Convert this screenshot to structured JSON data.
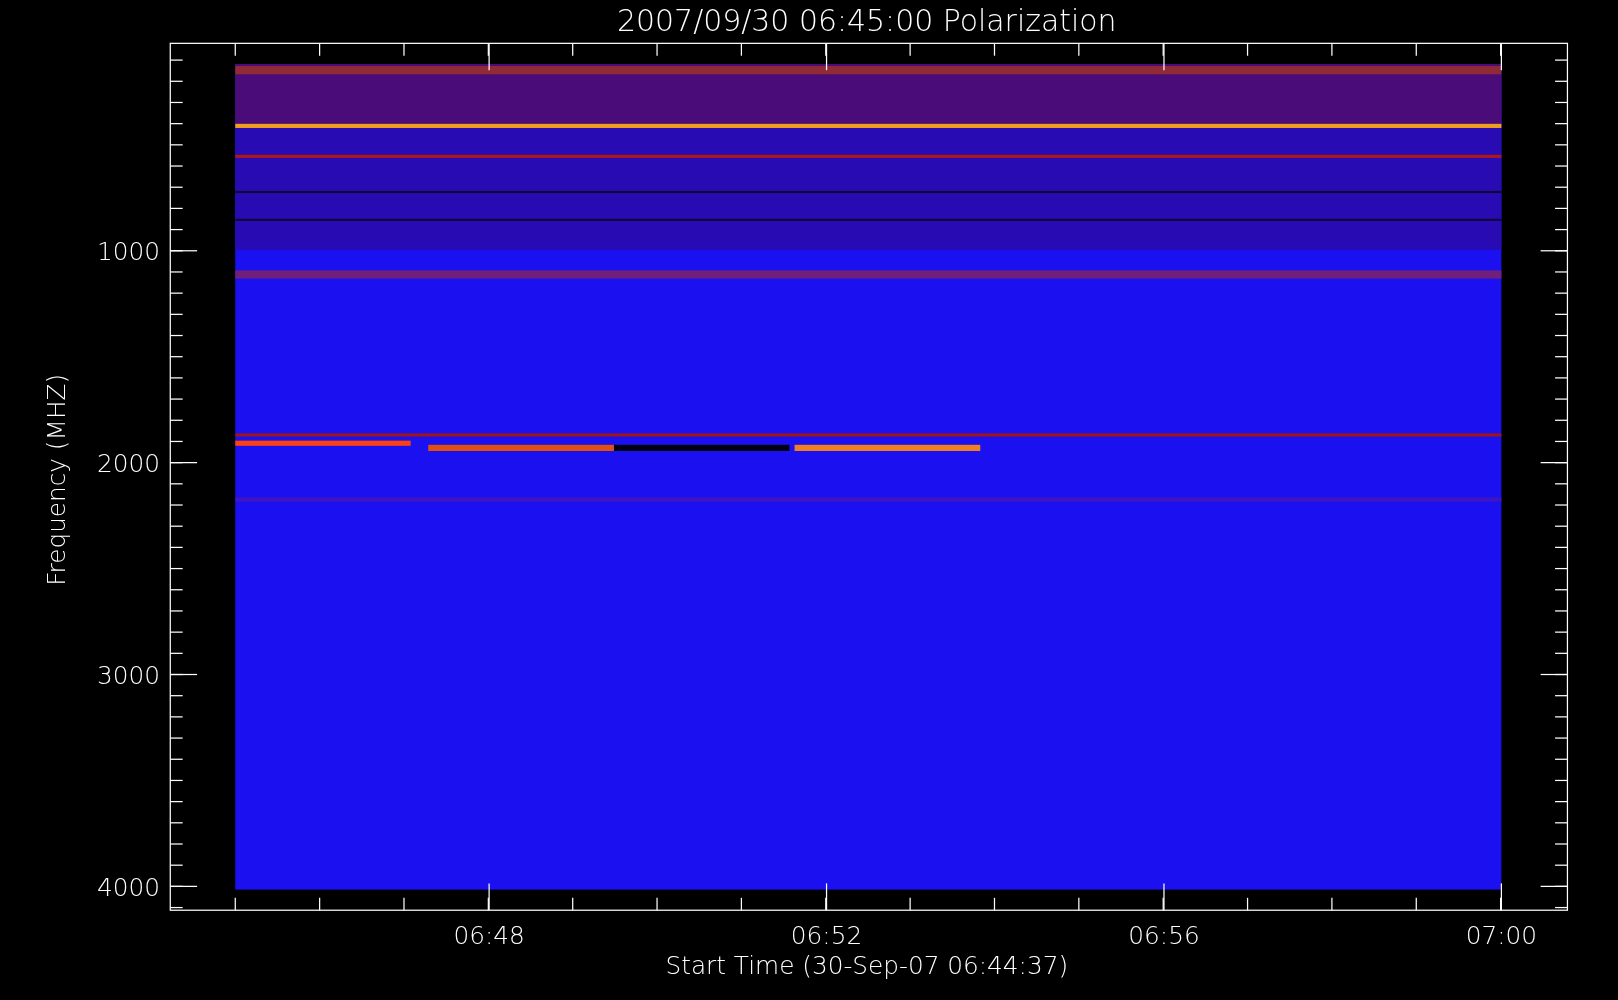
{
  "title": "2007/09/30 06:45:00 Polarization",
  "y_axis": {
    "label": "Frequency (MHZ)",
    "ticks": [
      "1000",
      "2000",
      "3000",
      "4000"
    ]
  },
  "x_axis": {
    "label": "Start Time (30-Sep-07 06:44:37)",
    "ticks": [
      "06:48",
      "06:52",
      "06:56",
      "07:00"
    ]
  }
}
